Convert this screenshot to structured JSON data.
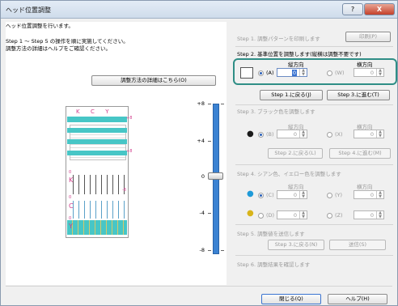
{
  "window": {
    "title": "ヘッド位置調整"
  },
  "titlebar": {
    "help_label": "?",
    "close_label": "X"
  },
  "intro": {
    "line1": "ヘッド位置調整を行います。",
    "line2": "Step 1 ～ Step 5 の操作を順に実施してください。",
    "line3": "調整方法の詳細はヘルプをご確認ください。"
  },
  "details_button": "調整方法の詳細はこちら(O)",
  "pattern": {
    "labels": [
      "K",
      "C",
      "Y"
    ],
    "marks": [
      "+8",
      "+8",
      "0",
      "-8",
      "0",
      "0"
    ]
  },
  "scale": {
    "labels": [
      "+8",
      "+4",
      "0",
      "-4",
      "-8"
    ],
    "value": 0,
    "min": -8,
    "max": 8
  },
  "step1": {
    "label": "Step 1. 調整パターンを印刷します",
    "print_button": "印刷(P)"
  },
  "step2": {
    "label": "Step 2. 基準位置を調整します(縦横は調整不要です)",
    "col_vertical": "縦方向",
    "col_horizontal": "横方向",
    "opt_a": "(A)",
    "opt_a_value": "0",
    "opt_w": "(W)",
    "opt_w_value": "0",
    "back_button": "Step 1.に戻る(J)",
    "next_button": "Step 3.に進む(T)"
  },
  "step3": {
    "label": "Step 3. ブラック色を調整します",
    "col_vertical": "縦方向",
    "col_horizontal": "横方向",
    "opt_b": "(B)",
    "opt_b_value": "0",
    "opt_x": "(X)",
    "opt_x_value": "0",
    "back_button": "Step 2.に戻る(L)",
    "next_button": "Step 4.に進む(M)"
  },
  "step4": {
    "label": "Step 4. シアン色、イエロー色を調整します",
    "col_vertical": "縦方向",
    "col_horizontal": "横方向",
    "opt_c": "(C)",
    "opt_c_value": "0",
    "opt_y": "(Y)",
    "opt_y_value": "0",
    "opt_d": "(D)",
    "opt_d_value": "0",
    "opt_z": "(Z)",
    "opt_z_value": "0"
  },
  "step5": {
    "label": "Step 5. 調整値を送信します",
    "back_button": "Step 3.に戻る(N)",
    "send_button": "送信(S)"
  },
  "step6": {
    "label": "Step 6. 調整結果を確認します"
  },
  "footer": {
    "close_button": "閉じる(Q)",
    "help_button": "ヘルプ(H)"
  },
  "colors": {
    "highlight": "#2f8e86",
    "accent": "#3b82d2",
    "pattern": "#47c6c6",
    "black": "#1a1a1a",
    "cyan": "#1f9ad8",
    "yellow": "#d8b41a"
  }
}
